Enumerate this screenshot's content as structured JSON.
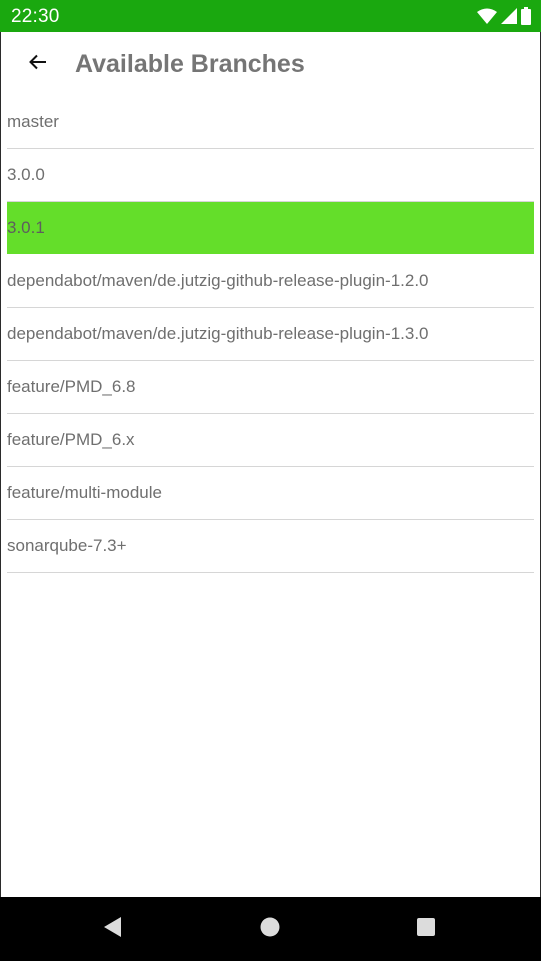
{
  "status_bar": {
    "time": "22:30",
    "color": "#1aa80f",
    "icons": [
      "wifi-icon",
      "signal-icon",
      "battery-icon"
    ]
  },
  "app_bar": {
    "back_icon": "arrow-left-icon",
    "title": "Available Branches"
  },
  "branches": {
    "selected_color": "#64de2a",
    "items": [
      {
        "label": "master",
        "selected": false
      },
      {
        "label": "3.0.0",
        "selected": false
      },
      {
        "label": "3.0.1",
        "selected": true
      },
      {
        "label": "dependabot/maven/de.jutzig-github-release-plugin-1.2.0",
        "selected": false
      },
      {
        "label": "dependabot/maven/de.jutzig-github-release-plugin-1.3.0",
        "selected": false
      },
      {
        "label": "feature/PMD_6.8",
        "selected": false
      },
      {
        "label": "feature/PMD_6.x",
        "selected": false
      },
      {
        "label": "feature/multi-module",
        "selected": false
      },
      {
        "label": "sonarqube-7.3+",
        "selected": false
      }
    ]
  },
  "nav_bar": {
    "icons": [
      "nav-back-icon",
      "nav-home-icon",
      "nav-recents-icon"
    ]
  }
}
